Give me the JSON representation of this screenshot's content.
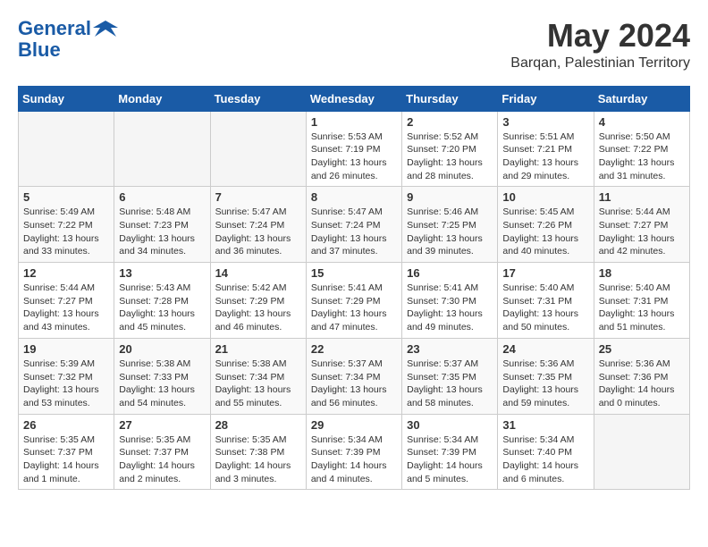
{
  "header": {
    "logo_line1": "General",
    "logo_line2": "Blue",
    "month": "May 2024",
    "location": "Barqan, Palestinian Territory"
  },
  "weekdays": [
    "Sunday",
    "Monday",
    "Tuesday",
    "Wednesday",
    "Thursday",
    "Friday",
    "Saturday"
  ],
  "weeks": [
    [
      {
        "day": "",
        "sunrise": "",
        "sunset": "",
        "daylight": ""
      },
      {
        "day": "",
        "sunrise": "",
        "sunset": "",
        "daylight": ""
      },
      {
        "day": "",
        "sunrise": "",
        "sunset": "",
        "daylight": ""
      },
      {
        "day": "1",
        "sunrise": "Sunrise: 5:53 AM",
        "sunset": "Sunset: 7:19 PM",
        "daylight": "Daylight: 13 hours and 26 minutes."
      },
      {
        "day": "2",
        "sunrise": "Sunrise: 5:52 AM",
        "sunset": "Sunset: 7:20 PM",
        "daylight": "Daylight: 13 hours and 28 minutes."
      },
      {
        "day": "3",
        "sunrise": "Sunrise: 5:51 AM",
        "sunset": "Sunset: 7:21 PM",
        "daylight": "Daylight: 13 hours and 29 minutes."
      },
      {
        "day": "4",
        "sunrise": "Sunrise: 5:50 AM",
        "sunset": "Sunset: 7:22 PM",
        "daylight": "Daylight: 13 hours and 31 minutes."
      }
    ],
    [
      {
        "day": "5",
        "sunrise": "Sunrise: 5:49 AM",
        "sunset": "Sunset: 7:22 PM",
        "daylight": "Daylight: 13 hours and 33 minutes."
      },
      {
        "day": "6",
        "sunrise": "Sunrise: 5:48 AM",
        "sunset": "Sunset: 7:23 PM",
        "daylight": "Daylight: 13 hours and 34 minutes."
      },
      {
        "day": "7",
        "sunrise": "Sunrise: 5:47 AM",
        "sunset": "Sunset: 7:24 PM",
        "daylight": "Daylight: 13 hours and 36 minutes."
      },
      {
        "day": "8",
        "sunrise": "Sunrise: 5:47 AM",
        "sunset": "Sunset: 7:24 PM",
        "daylight": "Daylight: 13 hours and 37 minutes."
      },
      {
        "day": "9",
        "sunrise": "Sunrise: 5:46 AM",
        "sunset": "Sunset: 7:25 PM",
        "daylight": "Daylight: 13 hours and 39 minutes."
      },
      {
        "day": "10",
        "sunrise": "Sunrise: 5:45 AM",
        "sunset": "Sunset: 7:26 PM",
        "daylight": "Daylight: 13 hours and 40 minutes."
      },
      {
        "day": "11",
        "sunrise": "Sunrise: 5:44 AM",
        "sunset": "Sunset: 7:27 PM",
        "daylight": "Daylight: 13 hours and 42 minutes."
      }
    ],
    [
      {
        "day": "12",
        "sunrise": "Sunrise: 5:44 AM",
        "sunset": "Sunset: 7:27 PM",
        "daylight": "Daylight: 13 hours and 43 minutes."
      },
      {
        "day": "13",
        "sunrise": "Sunrise: 5:43 AM",
        "sunset": "Sunset: 7:28 PM",
        "daylight": "Daylight: 13 hours and 45 minutes."
      },
      {
        "day": "14",
        "sunrise": "Sunrise: 5:42 AM",
        "sunset": "Sunset: 7:29 PM",
        "daylight": "Daylight: 13 hours and 46 minutes."
      },
      {
        "day": "15",
        "sunrise": "Sunrise: 5:41 AM",
        "sunset": "Sunset: 7:29 PM",
        "daylight": "Daylight: 13 hours and 47 minutes."
      },
      {
        "day": "16",
        "sunrise": "Sunrise: 5:41 AM",
        "sunset": "Sunset: 7:30 PM",
        "daylight": "Daylight: 13 hours and 49 minutes."
      },
      {
        "day": "17",
        "sunrise": "Sunrise: 5:40 AM",
        "sunset": "Sunset: 7:31 PM",
        "daylight": "Daylight: 13 hours and 50 minutes."
      },
      {
        "day": "18",
        "sunrise": "Sunrise: 5:40 AM",
        "sunset": "Sunset: 7:31 PM",
        "daylight": "Daylight: 13 hours and 51 minutes."
      }
    ],
    [
      {
        "day": "19",
        "sunrise": "Sunrise: 5:39 AM",
        "sunset": "Sunset: 7:32 PM",
        "daylight": "Daylight: 13 hours and 53 minutes."
      },
      {
        "day": "20",
        "sunrise": "Sunrise: 5:38 AM",
        "sunset": "Sunset: 7:33 PM",
        "daylight": "Daylight: 13 hours and 54 minutes."
      },
      {
        "day": "21",
        "sunrise": "Sunrise: 5:38 AM",
        "sunset": "Sunset: 7:34 PM",
        "daylight": "Daylight: 13 hours and 55 minutes."
      },
      {
        "day": "22",
        "sunrise": "Sunrise: 5:37 AM",
        "sunset": "Sunset: 7:34 PM",
        "daylight": "Daylight: 13 hours and 56 minutes."
      },
      {
        "day": "23",
        "sunrise": "Sunrise: 5:37 AM",
        "sunset": "Sunset: 7:35 PM",
        "daylight": "Daylight: 13 hours and 58 minutes."
      },
      {
        "day": "24",
        "sunrise": "Sunrise: 5:36 AM",
        "sunset": "Sunset: 7:35 PM",
        "daylight": "Daylight: 13 hours and 59 minutes."
      },
      {
        "day": "25",
        "sunrise": "Sunrise: 5:36 AM",
        "sunset": "Sunset: 7:36 PM",
        "daylight": "Daylight: 14 hours and 0 minutes."
      }
    ],
    [
      {
        "day": "26",
        "sunrise": "Sunrise: 5:35 AM",
        "sunset": "Sunset: 7:37 PM",
        "daylight": "Daylight: 14 hours and 1 minute."
      },
      {
        "day": "27",
        "sunrise": "Sunrise: 5:35 AM",
        "sunset": "Sunset: 7:37 PM",
        "daylight": "Daylight: 14 hours and 2 minutes."
      },
      {
        "day": "28",
        "sunrise": "Sunrise: 5:35 AM",
        "sunset": "Sunset: 7:38 PM",
        "daylight": "Daylight: 14 hours and 3 minutes."
      },
      {
        "day": "29",
        "sunrise": "Sunrise: 5:34 AM",
        "sunset": "Sunset: 7:39 PM",
        "daylight": "Daylight: 14 hours and 4 minutes."
      },
      {
        "day": "30",
        "sunrise": "Sunrise: 5:34 AM",
        "sunset": "Sunset: 7:39 PM",
        "daylight": "Daylight: 14 hours and 5 minutes."
      },
      {
        "day": "31",
        "sunrise": "Sunrise: 5:34 AM",
        "sunset": "Sunset: 7:40 PM",
        "daylight": "Daylight: 14 hours and 6 minutes."
      },
      {
        "day": "",
        "sunrise": "",
        "sunset": "",
        "daylight": ""
      }
    ]
  ]
}
